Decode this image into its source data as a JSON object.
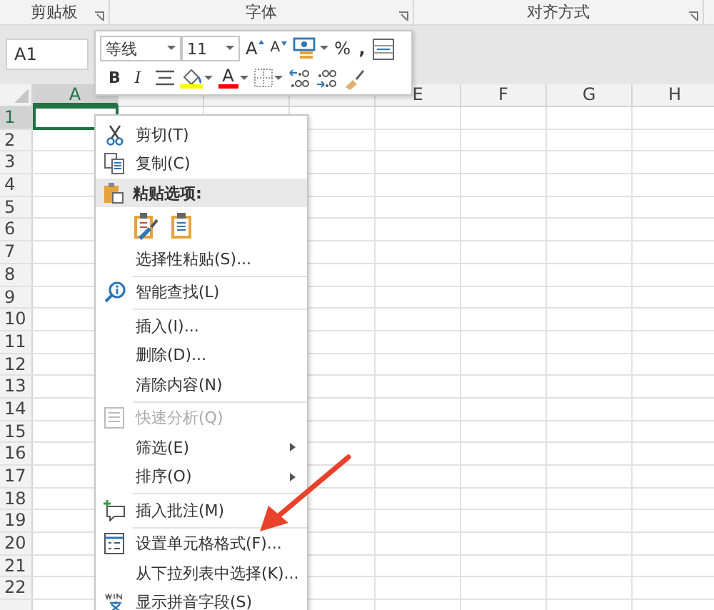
{
  "ribbon": {
    "groups": [
      {
        "label": "剪贴板"
      },
      {
        "label": "字体"
      },
      {
        "label": "对齐方式"
      }
    ]
  },
  "name_box": {
    "value": "A1"
  },
  "sheet": {
    "columns": [
      {
        "label": "A",
        "selected": true
      },
      {
        "selected": false
      },
      {
        "selected": false
      },
      {
        "selected": false
      },
      {
        "label": "E",
        "selected": false
      },
      {
        "label": "F",
        "selected": false
      },
      {
        "label": "G",
        "selected": false
      },
      {
        "label": "H",
        "selected": false
      }
    ],
    "rows": [
      {
        "label": "1",
        "selected": true
      },
      {
        "label": "2",
        "selected": false
      },
      {
        "label": "3",
        "selected": false
      },
      {
        "label": "4",
        "selected": false
      },
      {
        "label": "5",
        "selected": false
      },
      {
        "label": "6",
        "selected": false
      },
      {
        "label": "7",
        "selected": false
      },
      {
        "label": "8",
        "selected": false
      },
      {
        "label": "9",
        "selected": false
      },
      {
        "label": "10",
        "selected": false
      },
      {
        "label": "11",
        "selected": false
      },
      {
        "label": "12",
        "selected": false
      },
      {
        "label": "13",
        "selected": false
      },
      {
        "label": "14",
        "selected": false
      },
      {
        "label": "15",
        "selected": false
      },
      {
        "label": "16",
        "selected": false
      },
      {
        "label": "17",
        "selected": false
      },
      {
        "label": "18",
        "selected": false
      },
      {
        "label": "19",
        "selected": false
      },
      {
        "label": "20",
        "selected": false
      },
      {
        "label": "21",
        "selected": false
      },
      {
        "label": "22",
        "selected": false
      }
    ]
  },
  "mini_toolbar": {
    "font": "等线",
    "size": "11",
    "grow": "A",
    "shrink": "A",
    "percent": "%",
    "comma": ",",
    "bold": "B",
    "italic": "I",
    "font_color_label": "A"
  },
  "context_menu": {
    "items": [
      {
        "kind": "item",
        "text": "剪切(T)",
        "disabled": false,
        "submenu": false
      },
      {
        "kind": "item",
        "text": "复制(C)",
        "disabled": false,
        "submenu": false
      },
      {
        "kind": "header",
        "text": "粘贴选项:"
      },
      {
        "kind": "paste_icons"
      },
      {
        "kind": "item",
        "text": "选择性粘贴(S)...",
        "disabled": false,
        "submenu": false
      },
      {
        "kind": "separator"
      },
      {
        "kind": "item",
        "text": "智能查找(L)",
        "disabled": false,
        "submenu": false
      },
      {
        "kind": "separator"
      },
      {
        "kind": "item",
        "text": "插入(I)...",
        "disabled": false,
        "submenu": false
      },
      {
        "kind": "item",
        "text": "删除(D)...",
        "disabled": false,
        "submenu": false
      },
      {
        "kind": "item",
        "text": "清除内容(N)",
        "disabled": false,
        "submenu": false
      },
      {
        "kind": "separator"
      },
      {
        "kind": "item",
        "text": "快速分析(Q)",
        "disabled": true,
        "submenu": false
      },
      {
        "kind": "item",
        "text": "筛选(E)",
        "disabled": false,
        "submenu": true
      },
      {
        "kind": "item",
        "text": "排序(O)",
        "disabled": false,
        "submenu": true
      },
      {
        "kind": "separator"
      },
      {
        "kind": "item",
        "text": "插入批注(M)",
        "disabled": false,
        "submenu": false
      },
      {
        "kind": "separator"
      },
      {
        "kind": "item",
        "text": "设置单元格格式(F)...",
        "disabled": false,
        "submenu": false
      },
      {
        "kind": "item",
        "text": "从下拉列表中选择(K)...",
        "disabled": false,
        "submenu": false
      },
      {
        "kind": "item",
        "text": "显示拼音字段(S)",
        "disabled": false,
        "submenu": false
      }
    ]
  }
}
